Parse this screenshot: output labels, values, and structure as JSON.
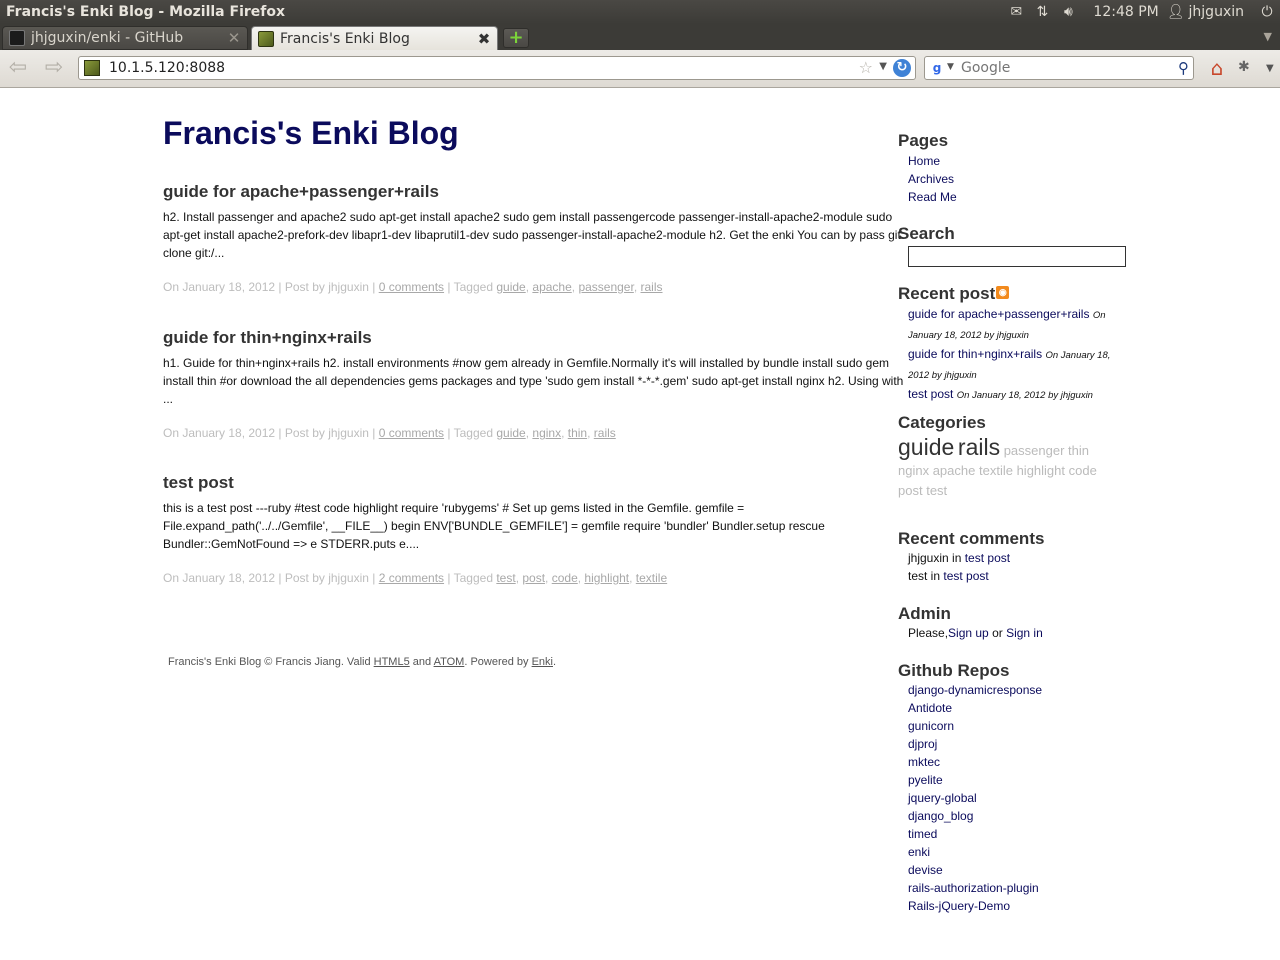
{
  "window": {
    "title": "Francis's Enki Blog - Mozilla Firefox"
  },
  "panel": {
    "clock": "12:48 PM",
    "user": "jhjguxin"
  },
  "tabs": [
    {
      "label": "jhjguxin/enki - GitHub"
    },
    {
      "label": "Francis's Enki Blog"
    }
  ],
  "toolbar": {
    "url": "10.1.5.120:8088",
    "search_placeholder": "Google"
  },
  "blog": {
    "title": "Francis's Enki Blog"
  },
  "posts": [
    {
      "title": "guide for apache+passenger+rails",
      "excerpt": "h2. Install passenger and apache2 sudo apt-get install apache2 sudo gem install passengercode passenger-install-apache2-module sudo apt-get install apache2-prefork-dev libapr1-dev libaprutil1-dev sudo passenger-install-apache2-module h2. Get the enki You can by pass git clone git:/...",
      "meta_prefix": "On January 18, 2012 | Post by jhjguxin | ",
      "comments": "0 comments",
      "tagged_label": " | Tagged ",
      "tags": [
        "guide",
        "apache",
        "passenger",
        "rails"
      ]
    },
    {
      "title": "guide for thin+nginx+rails",
      "excerpt": "h1. Guide for thin+nginx+rails h2. install environments #now gem already in Gemfile.Normally it's will installed by bundle install sudo gem install thin #or download the all dependencies gems packages and type 'sudo gem install *-*-*.gem' sudo apt-get install nginx h2. Using with ...",
      "meta_prefix": "On January 18, 2012 | Post by jhjguxin | ",
      "comments": "0 comments",
      "tagged_label": " | Tagged ",
      "tags": [
        "guide",
        "nginx",
        "thin",
        "rails"
      ]
    },
    {
      "title": "test post",
      "excerpt": "this is a test post ---ruby #test code highlight require 'rubygems' # Set up gems listed in the Gemfile. gemfile = File.expand_path('../../Gemfile', __FILE__) begin ENV['BUNDLE_GEMFILE'] = gemfile require 'bundler' Bundler.setup rescue Bundler::GemNotFound => e STDERR.puts e....",
      "meta_prefix": "On January 18, 2012 | Post by jhjguxin | ",
      "comments": "2 comments",
      "tagged_label": " | Tagged ",
      "tags": [
        "test",
        "post",
        "code",
        "highlight",
        "textile"
      ]
    }
  ],
  "footer": {
    "prefix": "Francis's Enki Blog © Francis Jiang. Valid ",
    "html5": "HTML5",
    "and": " and ",
    "atom": "ATOM",
    "powered": ". Powered by ",
    "enki": "Enki",
    "end": "."
  },
  "sidebar": {
    "pages_heading": "Pages",
    "pages": [
      "Home",
      "Archives",
      "Read Me"
    ],
    "search_heading": "Search",
    "recent_heading": "Recent post",
    "recent": [
      {
        "title": "guide for apache+passenger+rails",
        "meta": "On January 18, 2012 by jhjguxin"
      },
      {
        "title": "guide for thin+nginx+rails",
        "meta": "On January 18, 2012 by jhjguxin"
      },
      {
        "title": "test post",
        "meta": "On January 18, 2012 by jhjguxin"
      }
    ],
    "categories_heading": "Categories",
    "tags_big": [
      "guide",
      "rails"
    ],
    "tags_small": [
      "passenger",
      "thin",
      "nginx",
      "apache",
      "textile",
      "highlight",
      "code",
      "post",
      "test"
    ],
    "comments_heading": "Recent comments",
    "comments": [
      {
        "author": "jhjguxin",
        "in": " in ",
        "post": "test post"
      },
      {
        "author": "test",
        "in": " in ",
        "post": "test post"
      }
    ],
    "admin_heading": "Admin",
    "admin": {
      "please": "Please,",
      "signup": "Sign up",
      "or": " or ",
      "signin": "Sign in"
    },
    "github_heading": "Github Repos",
    "repos": [
      "django-dynamicresponse",
      "Antidote",
      "gunicorn",
      "djproj",
      "mktec",
      "pyelite",
      "jquery-global",
      "django_blog",
      "timed",
      "enki",
      "devise",
      "rails-authorization-plugin",
      "Rails-jQuery-Demo"
    ]
  }
}
